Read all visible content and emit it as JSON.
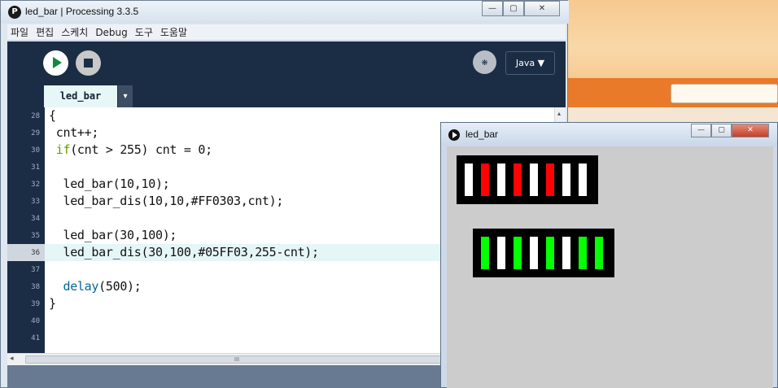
{
  "browser_bg": {
    "accent": "#e87a2a"
  },
  "ide": {
    "logo_glyph": "P",
    "title": "led_bar | Processing 3.3.5",
    "window_buttons": [
      "—",
      "▢",
      "✕"
    ],
    "menu": [
      "파일",
      "편집",
      "스케치",
      "Debug",
      "도구",
      "도움말"
    ],
    "toolbar": {
      "run_icon": "play-icon",
      "stop_icon": "stop-icon",
      "debug_glyph": "❋",
      "mode_label": "Java ▼"
    },
    "tab": {
      "label": "led_bar",
      "menu_glyph": "▾"
    },
    "editor": {
      "highlighted_line": 36,
      "lines": [
        {
          "num": "28",
          "code": "{"
        },
        {
          "num": "29",
          "code": " cnt++;"
        },
        {
          "num": "30",
          "code": " if(cnt > 255) cnt = 0;"
        },
        {
          "num": "31",
          "code": ""
        },
        {
          "num": "32",
          "code": "  led_bar(10,10);"
        },
        {
          "num": "33",
          "code": "  led_bar_dis(10,10,#FF0303,cnt);"
        },
        {
          "num": "34",
          "code": ""
        },
        {
          "num": "35",
          "code": "  led_bar(30,100);"
        },
        {
          "num": "36",
          "code": "  led_bar_dis(30,100,#05FF03,255-cnt);"
        },
        {
          "num": "37",
          "code": ""
        },
        {
          "num": "38",
          "code": "  delay(500);"
        },
        {
          "num": "39",
          "code": "}"
        },
        {
          "num": "40",
          "code": ""
        },
        {
          "num": "41",
          "code": ""
        }
      ]
    },
    "scroll": {
      "left_glyph": "◂",
      "up_glyph": "▴",
      "thumb_glyph": "III"
    }
  },
  "sketch": {
    "title": "led_bar",
    "window_buttons": [
      "—",
      "▢",
      "✕"
    ],
    "bar1": {
      "color": "#FF0303",
      "leds": [
        0,
        1,
        0,
        1,
        0,
        1,
        0,
        0
      ]
    },
    "bar2": {
      "color": "#05FF03",
      "leds": [
        1,
        0,
        1,
        0,
        1,
        0,
        1,
        1
      ]
    },
    "off_color": "#FFFFFF"
  }
}
